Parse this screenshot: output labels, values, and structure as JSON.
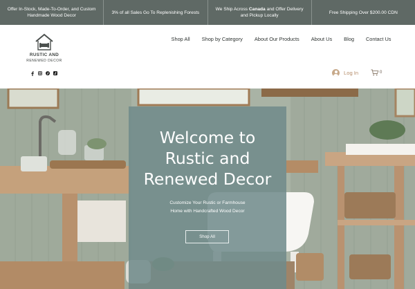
{
  "announcements": [
    {
      "text": "Offer In-Stock, Made-To-Order, and Custom Handmade Wood Decor"
    },
    {
      "text": "3% of all Sales Go To Replenishing Forests"
    },
    {
      "text_before": "We Ship Across ",
      "text_bold": "Canada",
      "text_after": " and Offer Delivery and Pickup Locally"
    },
    {
      "text": "Free Shipping Over $200.00 CDN"
    }
  ],
  "logo": {
    "line1": "RUSTIC AND",
    "line2": "RENEWED DECOR",
    "icon": "house-sofa-icon"
  },
  "nav": [
    "Shop All",
    "Shop by Category",
    "About Our Products",
    "About Us",
    "Blog",
    "Contact Us"
  ],
  "social": [
    "facebook-icon",
    "instagram-icon",
    "pinterest-icon",
    "tiktok-icon"
  ],
  "login": {
    "label": "Log In",
    "icon": "avatar-icon"
  },
  "cart": {
    "count": "0",
    "icon": "cart-icon"
  },
  "hero": {
    "headline_lines": [
      "Welcome to",
      "Rustic and",
      "Renewed Decor"
    ],
    "tagline": "Customize Your Rustic or Farmhouse Home with Handcrafted Wood Decor",
    "cta": "Shop All"
  },
  "colors": {
    "topbar": "#5f6965",
    "panel": "#708a8a",
    "accent": "#b58c69"
  }
}
